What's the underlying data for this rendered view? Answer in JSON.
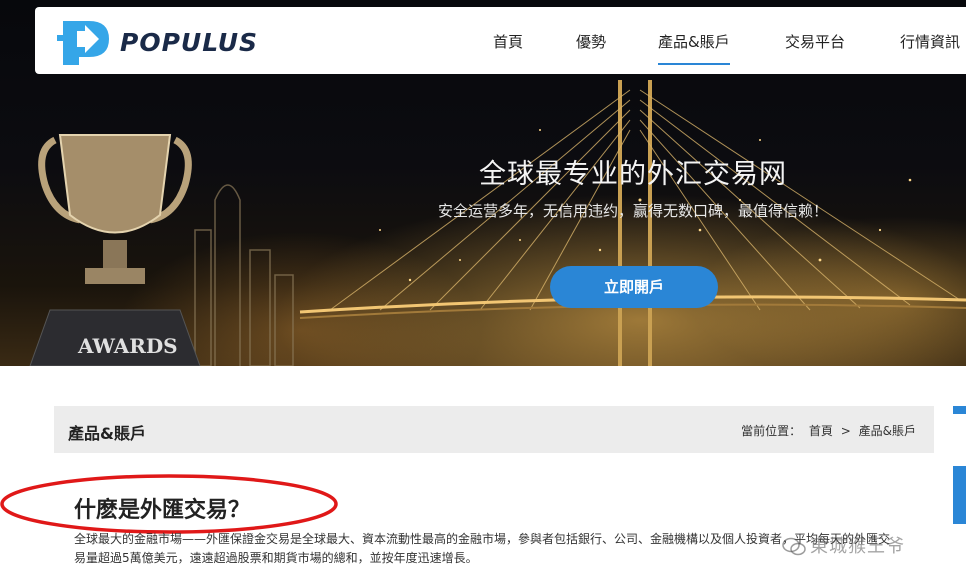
{
  "header": {
    "brand": "POPULUS",
    "nav": [
      {
        "label": "首頁"
      },
      {
        "label": "優勢"
      },
      {
        "label": "產品&賬戶",
        "active": true
      },
      {
        "label": "交易平台"
      },
      {
        "label": "行情資訊"
      }
    ]
  },
  "hero": {
    "title": "全球最专业的外汇交易网",
    "subtitle": "安全运营多年，无信用违约，赢得无数口碑，最值得信赖！",
    "cta_label": "立即開戶",
    "trophy_text": "AWARDS"
  },
  "breadcrumb": {
    "section_title": "產品&賬戶",
    "prefix": "當前位置：",
    "items": [
      "首頁",
      "產品&賬戶"
    ],
    "separator": ">"
  },
  "article": {
    "title": "什麽是外匯交易？",
    "body": "全球最大的金融市場——外匯保證金交易是全球最大、資本流動性最高的金融市場，參與者包括銀行、公司、金融機構以及個人投資者，平均每天的外匯交易量超過5萬億美元，遠遠超過股票和期貨市場的總和，並按年度迅速增長。"
  },
  "watermark": {
    "text": "東城猴王爷",
    "icon": "wechat-icon"
  },
  "colors": {
    "accent": "#2a86d6",
    "brand_dark": "#1a2a48",
    "annotation": "#e01818"
  }
}
